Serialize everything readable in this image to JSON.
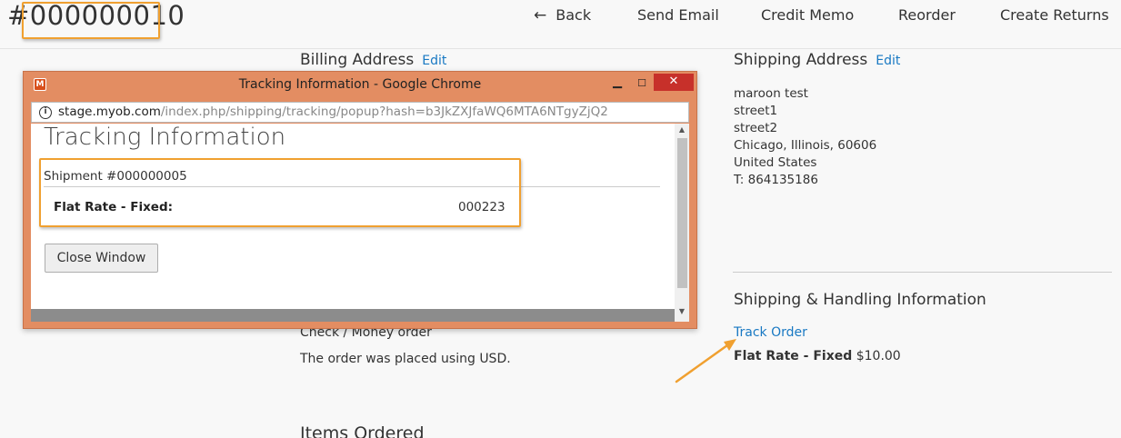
{
  "header": {
    "order_number": "#000000010",
    "actions": {
      "back": "Back",
      "send_email": "Send Email",
      "credit_memo": "Credit Memo",
      "reorder": "Reorder",
      "create_returns": "Create Returns"
    }
  },
  "billing": {
    "title": "Billing Address",
    "edit": "Edit"
  },
  "shipping": {
    "title": "Shipping Address",
    "edit": "Edit",
    "address_lines": [
      "maroon test",
      "street1",
      "street2",
      "Chicago, Illinois, 60606",
      "United States",
      "T: 864135186"
    ]
  },
  "shipping_handling": {
    "title": "Shipping & Handling Information",
    "track_order": "Track Order",
    "method_label": "Flat Rate - Fixed",
    "method_price": "$10.00"
  },
  "payment": {
    "method": "Check / Money order",
    "currency_note": "The order was placed using USD."
  },
  "items_ordered": {
    "title": "Items Ordered"
  },
  "popup": {
    "window_title": "Tracking Information - Google Chrome",
    "url_host": "stage.myob.com",
    "url_path": "/index.php/shipping/tracking/popup?hash=b3JkZXJfaWQ6MTA6NTgyZjQ2",
    "heading": "Tracking Information",
    "shipment_label": "Shipment #000000005",
    "carrier_label": "Flat Rate - Fixed:",
    "tracking_number": "000223",
    "close_button": "Close Window"
  },
  "colors": {
    "link": "#1979c3",
    "highlight": "#f0a030",
    "popup_frame": "#e38d62",
    "window_close": "#c7302a"
  }
}
